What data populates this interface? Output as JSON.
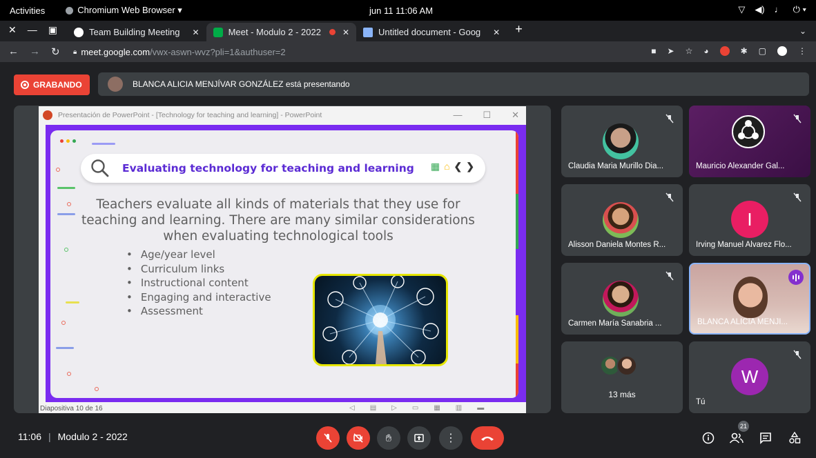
{
  "system_bar": {
    "activities": "Activities",
    "app_name": "Chromium Web Browser ▾",
    "clock": "jun 11  11:06 AM"
  },
  "tabs": [
    {
      "title": "Team Building Meeting",
      "favicon_color": "#ffffff"
    },
    {
      "title": "Meet - Modulo 2 - 2022",
      "favicon_color": "#00ac47",
      "recording": true
    },
    {
      "title": "Untitled document - Goog",
      "favicon_color": "#8ab4f8"
    }
  ],
  "new_tab": "+",
  "address_bar": {
    "host": "meet.google.com",
    "path": "/vwx-aswn-wvz?pli=1&authuser=2"
  },
  "meet_header": {
    "recording_label": "GRABANDO",
    "presenting_text": "BLANCA ALICIA MENJÍVAR GONZÁLEZ está presentando"
  },
  "ppt": {
    "window_title": "Presentación de PowerPoint - [Technology for teaching and learning] - PowerPoint",
    "status": "Diapositiva 10 de 16",
    "slide": {
      "heading": "Evaluating technology for teaching and learning",
      "body_lines": [
        "Teachers evaluate all kinds of materials that they use for",
        "teaching and learning. There are many similar considerations",
        "when evaluating technological tools"
      ],
      "bullets": [
        "Age/year level",
        "Curriculum links",
        "Instructional content",
        "Engaging and interactive",
        "Assessment"
      ],
      "icons": [
        "calendar-icon",
        "home-icon",
        "chevron-left-icon",
        "chevron-right-icon"
      ]
    }
  },
  "participants": [
    {
      "name": "Claudia Maria Murillo Dia...",
      "type": "photo",
      "muted": true
    },
    {
      "name": "Mauricio Alexander Gal...",
      "type": "logo",
      "muted": true
    },
    {
      "name": "Alisson Daniela Montes R...",
      "type": "photo",
      "muted": true
    },
    {
      "name": "Irving Manuel Alvarez Flo...",
      "type": "letter",
      "letter": "I",
      "color": "#e91e63",
      "muted": true
    },
    {
      "name": "Carmen María Sanabria ...",
      "type": "photo",
      "muted": true
    },
    {
      "name": "BLANCA ALICIA MENJÍ...",
      "type": "video",
      "speaking": true
    },
    {
      "name": "13 más",
      "type": "group"
    },
    {
      "name": "Tú",
      "type": "letter",
      "letter": "W",
      "color": "#9c27b0",
      "muted": true
    }
  ],
  "bottom_bar": {
    "time": "11:06",
    "separator": "|",
    "meeting_name": "Modulo 2 - 2022",
    "people_count": "21"
  },
  "colors": {
    "meet_red": "#ea4335",
    "slide_frame": "#7a2cf0",
    "heading": "#5b2bd4"
  }
}
